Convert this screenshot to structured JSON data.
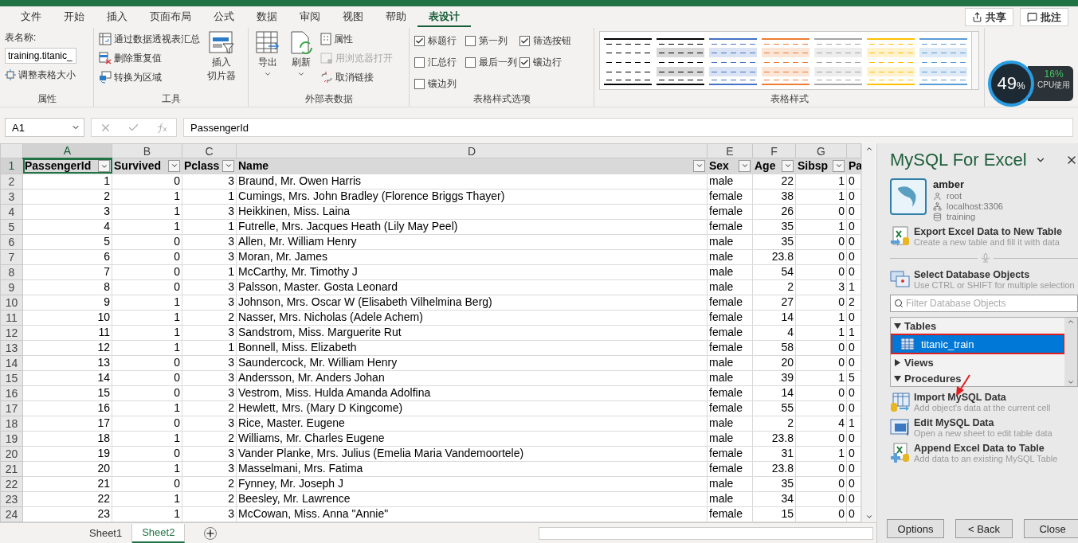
{
  "menu": {
    "tabs": [
      {
        "label": "文件",
        "selected": false
      },
      {
        "label": "开始",
        "selected": false
      },
      {
        "label": "插入",
        "selected": false
      },
      {
        "label": "页面布局",
        "selected": false
      },
      {
        "label": "公式",
        "selected": false
      },
      {
        "label": "数据",
        "selected": false
      },
      {
        "label": "审阅",
        "selected": false
      },
      {
        "label": "视图",
        "selected": false
      },
      {
        "label": "帮助",
        "selected": false
      },
      {
        "label": "表设计",
        "selected": true
      }
    ],
    "share": "共享",
    "comment": "批注"
  },
  "ribbon": {
    "properties": {
      "label": "属性",
      "name_label": "表名称:",
      "name_value": "training.titanic_",
      "resize": "调整表格大小"
    },
    "tools": {
      "label": "工具",
      "items": [
        {
          "kind": "pivot",
          "label": "通过数据透视表汇总"
        },
        {
          "kind": "dedupe",
          "label": "删除重复值"
        },
        {
          "kind": "convert",
          "label": "转换为区域"
        }
      ],
      "slicer": [
        "插入",
        "切片器"
      ]
    },
    "external": {
      "label": "外部表数据",
      "export": "导出",
      "refresh": "刷新",
      "items": [
        {
          "kind": "props",
          "label": "属性",
          "disabled": false
        },
        {
          "kind": "browser",
          "label": "用浏览器打开",
          "disabled": true
        },
        {
          "kind": "unlink",
          "label": "取消链接",
          "disabled": false
        }
      ]
    },
    "style_options": {
      "label": "表格样式选项",
      "options": [
        {
          "label": "标题行",
          "checked": true
        },
        {
          "label": "第一列",
          "checked": false
        },
        {
          "label": "筛选按钮",
          "checked": true
        },
        {
          "label": "汇总行",
          "checked": false
        },
        {
          "label": "最后一列",
          "checked": false
        },
        {
          "label": "镶边行",
          "checked": true
        },
        {
          "label": "镶边列",
          "checked": false
        }
      ]
    },
    "styles": {
      "label": "表格样式",
      "swatches": [
        {
          "color": "#000000"
        },
        {
          "color": "#000000"
        },
        {
          "color": "#4472c4"
        },
        {
          "color": "#ed7d31"
        },
        {
          "color": "#a5a5a5"
        },
        {
          "color": "#ffc000"
        },
        {
          "color": "#5b9bd5"
        }
      ]
    }
  },
  "cpu": {
    "percent": "49",
    "unit": "%",
    "usage": "16%",
    "label": "CPU使用"
  },
  "formula_bar": {
    "name_box": "A1",
    "value": "PassengerId"
  },
  "sheet": {
    "column_letters": [
      "A",
      "B",
      "C",
      "D",
      "E",
      "F",
      "G"
    ],
    "header_row": {
      "number": "1",
      "cells": [
        "PassengerId",
        "Survived",
        "Pclass",
        "Name",
        "Sex",
        "Age",
        "Sibsp",
        "Pa"
      ]
    },
    "rows": [
      {
        "number": "2",
        "cells": [
          "1",
          "0",
          "3",
          "Braund, Mr. Owen Harris",
          "male",
          "22",
          "1",
          "0"
        ]
      },
      {
        "number": "3",
        "cells": [
          "2",
          "1",
          "1",
          "Cumings, Mrs. John Bradley (Florence Briggs Thayer)",
          "female",
          "38",
          "1",
          "0"
        ]
      },
      {
        "number": "4",
        "cells": [
          "3",
          "1",
          "3",
          "Heikkinen, Miss. Laina",
          "female",
          "26",
          "0",
          "0"
        ]
      },
      {
        "number": "5",
        "cells": [
          "4",
          "1",
          "1",
          "Futrelle, Mrs. Jacques Heath (Lily May Peel)",
          "female",
          "35",
          "1",
          "0"
        ]
      },
      {
        "number": "6",
        "cells": [
          "5",
          "0",
          "3",
          "Allen, Mr. William Henry",
          "male",
          "35",
          "0",
          "0"
        ]
      },
      {
        "number": "7",
        "cells": [
          "6",
          "0",
          "3",
          "Moran, Mr. James",
          "male",
          "23.8",
          "0",
          "0"
        ]
      },
      {
        "number": "8",
        "cells": [
          "7",
          "0",
          "1",
          "McCarthy, Mr. Timothy J",
          "male",
          "54",
          "0",
          "0"
        ]
      },
      {
        "number": "9",
        "cells": [
          "8",
          "0",
          "3",
          "Palsson, Master. Gosta Leonard",
          "male",
          "2",
          "3",
          "1"
        ]
      },
      {
        "number": "10",
        "cells": [
          "9",
          "1",
          "3",
          "Johnson, Mrs. Oscar W (Elisabeth Vilhelmina Berg)",
          "female",
          "27",
          "0",
          "2"
        ]
      },
      {
        "number": "11",
        "cells": [
          "10",
          "1",
          "2",
          "Nasser, Mrs. Nicholas (Adele Achem)",
          "female",
          "14",
          "1",
          "0"
        ]
      },
      {
        "number": "12",
        "cells": [
          "11",
          "1",
          "3",
          "Sandstrom, Miss. Marguerite Rut",
          "female",
          "4",
          "1",
          "1"
        ]
      },
      {
        "number": "13",
        "cells": [
          "12",
          "1",
          "1",
          "Bonnell, Miss. Elizabeth",
          "female",
          "58",
          "0",
          "0"
        ]
      },
      {
        "number": "14",
        "cells": [
          "13",
          "0",
          "3",
          "Saundercock, Mr. William Henry",
          "male",
          "20",
          "0",
          "0"
        ]
      },
      {
        "number": "15",
        "cells": [
          "14",
          "0",
          "3",
          "Andersson, Mr. Anders Johan",
          "male",
          "39",
          "1",
          "5"
        ]
      },
      {
        "number": "16",
        "cells": [
          "15",
          "0",
          "3",
          "Vestrom, Miss. Hulda Amanda Adolfina",
          "female",
          "14",
          "0",
          "0"
        ]
      },
      {
        "number": "17",
        "cells": [
          "16",
          "1",
          "2",
          "Hewlett, Mrs. (Mary D Kingcome)",
          "female",
          "55",
          "0",
          "0"
        ]
      },
      {
        "number": "18",
        "cells": [
          "17",
          "0",
          "3",
          "Rice, Master. Eugene",
          "male",
          "2",
          "4",
          "1"
        ]
      },
      {
        "number": "19",
        "cells": [
          "18",
          "1",
          "2",
          "Williams, Mr. Charles Eugene",
          "male",
          "23.8",
          "0",
          "0"
        ]
      },
      {
        "number": "20",
        "cells": [
          "19",
          "0",
          "3",
          "Vander Planke, Mrs. Julius (Emelia Maria Vandemoortele)",
          "female",
          "31",
          "1",
          "0"
        ]
      },
      {
        "number": "21",
        "cells": [
          "20",
          "1",
          "3",
          "Masselmani, Mrs. Fatima",
          "female",
          "23.8",
          "0",
          "0"
        ]
      },
      {
        "number": "22",
        "cells": [
          "21",
          "0",
          "2",
          "Fynney, Mr. Joseph J",
          "male",
          "35",
          "0",
          "0"
        ]
      },
      {
        "number": "23",
        "cells": [
          "22",
          "1",
          "2",
          "Beesley, Mr. Lawrence",
          "male",
          "34",
          "0",
          "0"
        ]
      },
      {
        "number": "24",
        "cells": [
          "23",
          "1",
          "3",
          "McCowan, Miss. Anna \"Annie\"",
          "female",
          "15",
          "0",
          "0"
        ]
      }
    ]
  },
  "sheet_tabs": [
    {
      "label": "Sheet1",
      "selected": false
    },
    {
      "label": "Sheet2",
      "selected": true
    }
  ],
  "sidebar": {
    "title": "MySQL For Excel",
    "connection": {
      "name": "amber",
      "user": "root",
      "host": "localhost:3306",
      "schema": "training"
    },
    "export": {
      "title": "Export Excel Data to New Table",
      "description": "Create a new table and fill it with data"
    },
    "select": {
      "title": "Select Database Objects",
      "description": "Use CTRL or SHIFT for multiple selection",
      "filter_placeholder": "Filter Database Objects",
      "tree": [
        {
          "label": "Tables",
          "expanded": true,
          "children": [
            {
              "label": "titanic_train",
              "selected": true,
              "annotated": true
            }
          ]
        },
        {
          "label": "Views",
          "expanded": false
        },
        {
          "label": "Procedures",
          "expanded": true
        }
      ]
    },
    "actions": [
      {
        "kind": "import",
        "title": "Import MySQL Data",
        "description": "Add object's data at the current cell"
      },
      {
        "kind": "edit",
        "title": "Edit MySQL Data",
        "description": "Open a new sheet to edit table data"
      },
      {
        "kind": "append",
        "title": "Append Excel Data to Table",
        "description": "Add data to an existing MySQL Table"
      }
    ],
    "buttons": [
      "Options",
      "< Back",
      "Close"
    ]
  }
}
